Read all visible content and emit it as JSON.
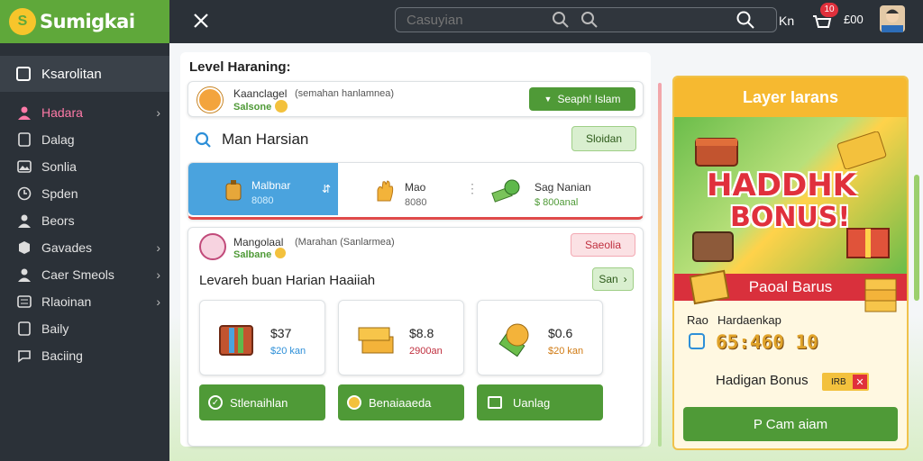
{
  "app": {
    "logo_letter": "S",
    "name": "Sumigkai"
  },
  "search": {
    "placeholder": "Casuyian"
  },
  "topbar": {
    "user_code": "Kn",
    "notif_count": "10",
    "coins": "£00"
  },
  "sidebar": {
    "header": "Ksarolitan",
    "items": [
      {
        "label": "Hadara",
        "chevron": "›"
      },
      {
        "label": "Dalag"
      },
      {
        "label": "Sonlia"
      },
      {
        "label": "Spden"
      },
      {
        "label": "Beors"
      },
      {
        "label": "Gavades",
        "chevron": "›"
      },
      {
        "label": "Caer Smeols",
        "chevron": "›"
      },
      {
        "label": "Rlaoinan",
        "chevron": "›"
      },
      {
        "label": "Baily"
      },
      {
        "label": "Baciing"
      }
    ]
  },
  "main": {
    "title": "Level Haraning:",
    "profile": {
      "name": "Kaanclagel",
      "desc": "(semahan hanlamnea)",
      "status": "Salsone",
      "action": "Seaph! Islam"
    },
    "section": {
      "title": "Man Harsian",
      "button": "Sloidan"
    },
    "tabs": [
      {
        "title": "Malbnar",
        "value": "8080"
      },
      {
        "title": "Mao",
        "value": "8080"
      },
      {
        "title": "Sag Nanian",
        "value": "$ 800anal"
      }
    ],
    "profile2": {
      "name": "Mangolaal",
      "desc": "(Marahan (Sanlarmea)",
      "status": "Salbane",
      "action": "Saeolia"
    },
    "rewards": {
      "title": "Levareh buan Harian Haaiiah",
      "nav": "San",
      "items": [
        {
          "value": "$37",
          "sub": "$20 kan"
        },
        {
          "value": "$8.8",
          "sub": "2900an"
        },
        {
          "value": "$0.6",
          "sub": "$20 kan"
        }
      ],
      "buttons": [
        "Stlenaihlan",
        "Benaiaaeda",
        "Uanlag"
      ]
    }
  },
  "bonus": {
    "header": "Layer Iarans",
    "banner_line1": "HADDHK",
    "banner_line2": "BONUS!",
    "ribbon": "Paoal Barus",
    "info_label": "Rao",
    "info_value": "Hardaenkap",
    "timer": "65:460 10",
    "claim_label": "Hadigan Bonus",
    "claim_tag": "IRB",
    "cta": "P Cam aiam"
  }
}
